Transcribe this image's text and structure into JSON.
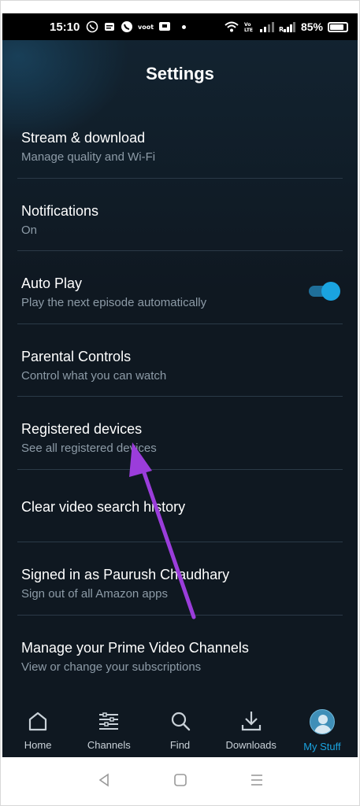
{
  "statusbar": {
    "time": "15:10",
    "battery": "85%",
    "icons": [
      "whatsapp-icon",
      "message-icon",
      "phone-icon",
      "voot-icon",
      "tv-icon",
      "wifi-icon",
      "volte-icon",
      "signal-icon",
      "signal-icon"
    ]
  },
  "header": {
    "title": "Settings"
  },
  "settings": [
    {
      "title": "Stream & download",
      "subtitle": "Manage quality and Wi-Fi"
    },
    {
      "title": "Notifications",
      "subtitle": "On"
    },
    {
      "title": "Auto Play",
      "subtitle": "Play the next episode automatically",
      "toggle": true
    },
    {
      "title": "Parental Controls",
      "subtitle": "Control what you can watch"
    },
    {
      "title": "Registered devices",
      "subtitle": "See all registered devices"
    },
    {
      "title": "Clear video search history"
    },
    {
      "title": "Signed in as Paurush Chaudhary",
      "subtitle": "Sign out of all Amazon apps"
    },
    {
      "title": "Manage your Prime Video Channels",
      "subtitle": "View or change your subscriptions"
    }
  ],
  "bottomnav": {
    "items": [
      {
        "label": "Home",
        "icon": "home-icon"
      },
      {
        "label": "Channels",
        "icon": "channels-icon"
      },
      {
        "label": "Find",
        "icon": "search-icon"
      },
      {
        "label": "Downloads",
        "icon": "download-icon"
      },
      {
        "label": "My Stuff",
        "icon": "avatar",
        "active": true
      }
    ]
  },
  "colors": {
    "background": "#0f1821",
    "accent": "#1aa3e0",
    "annotation_arrow": "#9b3ddb"
  }
}
